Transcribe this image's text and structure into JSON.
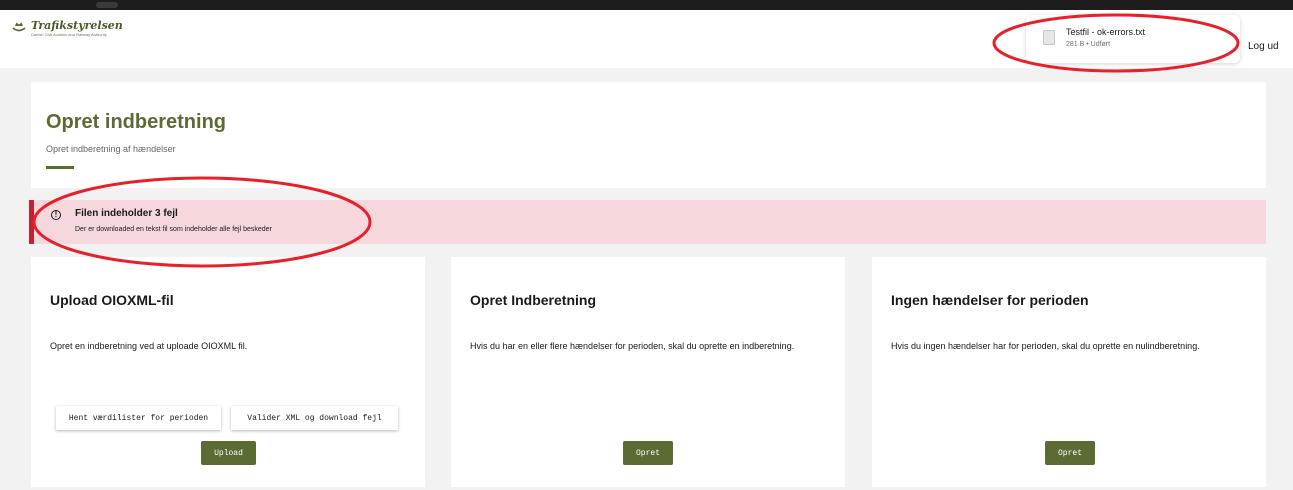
{
  "header": {
    "logo_name": "Trafikstyrelsen",
    "logo_subtitle": "Danish Civil Aviation and Railway Authority",
    "logout_label": "Log ud"
  },
  "download": {
    "file_name": "Testfil - ok-errors.txt",
    "file_meta": "281 B • Udført"
  },
  "page": {
    "title": "Opret indberetning",
    "subtitle": "Opret indberetning af hændelser"
  },
  "alert": {
    "title": "Filen indeholder 3 fejl",
    "message": "Der er downloaded en tekst fil som indeholder alle fejl beskeder"
  },
  "cards": [
    {
      "title": "Upload OIOXML-fil",
      "text": "Opret en indberetning ved at uploade OIOXML fil.",
      "buttons": [
        "Hent værdilister for perioden",
        "Valider XML og download fejl"
      ],
      "primary": "Upload"
    },
    {
      "title": "Opret Indberetning",
      "text": "Hvis du har en eller flere hændelser for perioden, skal du oprette en indberetning.",
      "primary": "Opret"
    },
    {
      "title": "Ingen hændelser for perioden",
      "text": "Hvis du ingen hændelser har for perioden, skal du oprette en nulindberetning.",
      "primary": "Opret"
    }
  ],
  "colors": {
    "brand_green": "#5a6b33",
    "alert_background": "#f6d8dc",
    "alert_accent": "#c0222f",
    "annotation_red": "#e8202a"
  }
}
